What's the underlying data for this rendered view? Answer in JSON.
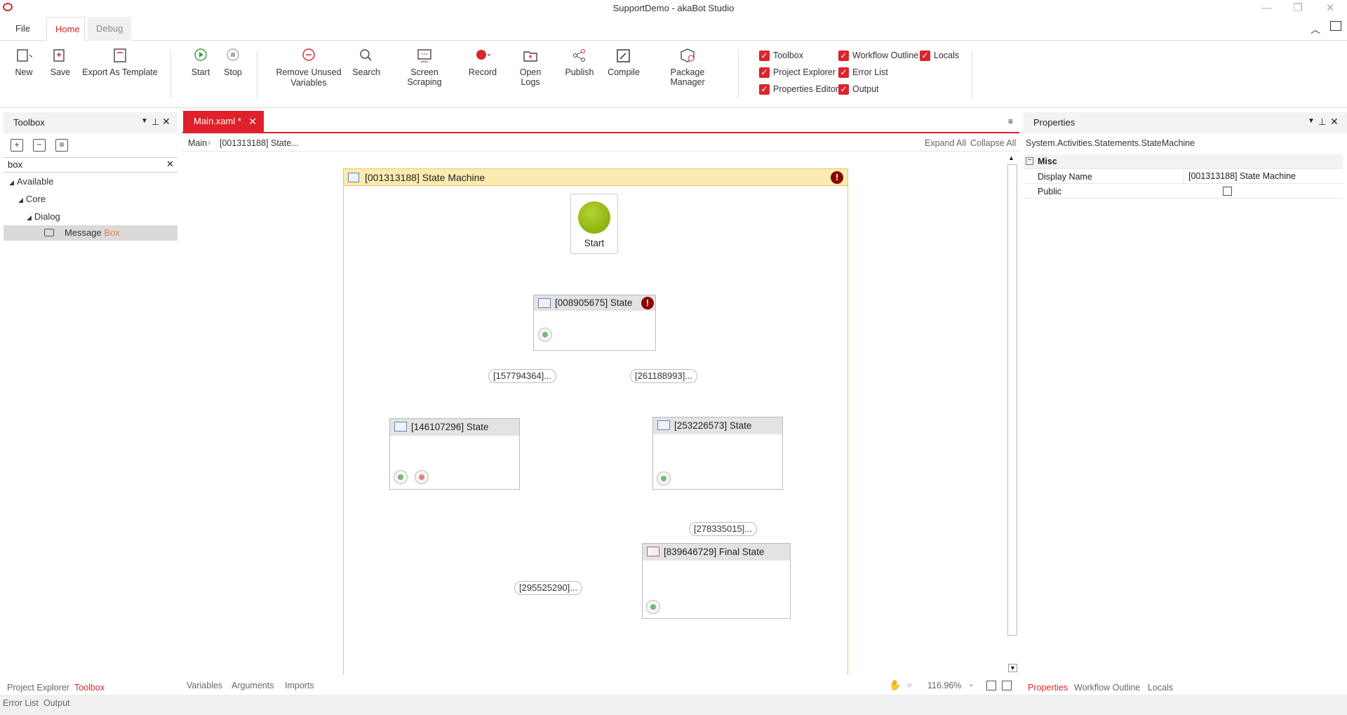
{
  "window": {
    "title": "SupportDemo - akaBot Studio"
  },
  "ribbon_tabs": [
    "File",
    "Home",
    "Debug"
  ],
  "ribbon": {
    "new": "New",
    "save": "Save",
    "export_template": "Export As Template",
    "start": "Start",
    "stop": "Stop",
    "remove_unused_1": "Remove Unused",
    "remove_unused_2": "Variables",
    "search": "Search",
    "screen_scraping": "Screen Scraping",
    "record": "Record",
    "open_logs": "Open Logs",
    "publish": "Publish",
    "compile": "Compile",
    "package_manager": "Package Manager"
  },
  "panel_toggles": {
    "toolbox": "Toolbox",
    "project_explorer": "Project Explorer",
    "properties_editor": "Properties Editor",
    "workflow_outline": "Workflow Outline",
    "error_list": "Error List",
    "output": "Output",
    "locals": "Locals"
  },
  "toolbox": {
    "title": "Toolbox",
    "search_value": "box",
    "tree": {
      "available": "Available",
      "core": "Core",
      "dialog": "Dialog",
      "message": "Message",
      "box_match": "Box"
    }
  },
  "document": {
    "tab_label": "Main.xaml *",
    "breadcrumb": {
      "root": "Main",
      "current": "[001313188] State..."
    },
    "expand_all": "Expand All",
    "collapse_all": "Collapse All"
  },
  "canvas": {
    "state_machine_title": "[001313188] State Machine",
    "start_label": "Start",
    "states": {
      "s1": "[008905675] State",
      "s2": "[146107296] State",
      "s3": "[253226573] State",
      "final": "[839646729] Final State"
    },
    "transitions": {
      "t1": "[157794364]...",
      "t2": "[261188993]...",
      "t3": "[278335015]...",
      "t4": "[295525290]..."
    },
    "zoom": "116.96%"
  },
  "doc_bottom_tabs": [
    "Variables",
    "Arguments",
    "Imports"
  ],
  "properties": {
    "title": "Properties",
    "type_name": "System.Activities.Statements.StateMachine",
    "category": "Misc",
    "display_name_label": "Display Name",
    "display_name_value": "[001313188] State Machine",
    "public_label": "Public"
  },
  "bottom_tabs": {
    "left": [
      "Project Explorer",
      "Toolbox"
    ],
    "left2": [
      "Error List",
      "Output"
    ],
    "right": [
      "Properties",
      "Workflow Outline",
      "Locals"
    ]
  },
  "colors": {
    "accent": "#d9262b",
    "start_node": "#8db600",
    "error": "#8b0000"
  }
}
